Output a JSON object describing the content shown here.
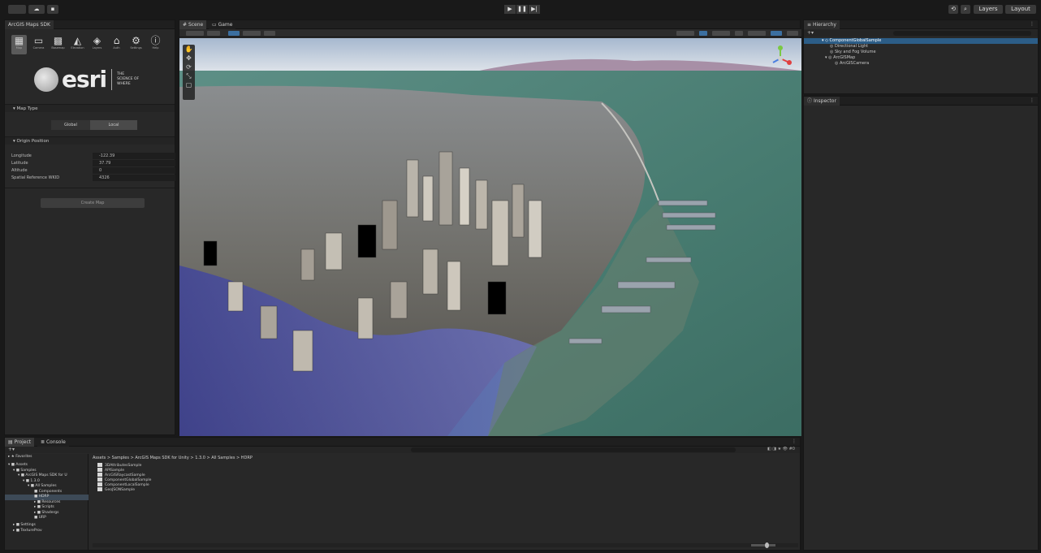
{
  "topbar": {
    "right_layers": "Layers",
    "right_layout": "Layout",
    "play_icons": [
      "play-icon",
      "pause-icon",
      "step-icon"
    ]
  },
  "arcgis_panel": {
    "tab_title": "ArcGIS Maps SDK",
    "tools": [
      {
        "label": "Map",
        "icon": "map-icon"
      },
      {
        "label": "Camera",
        "icon": "camera-icon"
      },
      {
        "label": "Basemap",
        "icon": "basemap-icon"
      },
      {
        "label": "Elevation",
        "icon": "elevation-icon"
      },
      {
        "label": "Layers",
        "icon": "layers-icon"
      },
      {
        "label": "Auth",
        "icon": "auth-icon"
      },
      {
        "label": "Settings",
        "icon": "settings-icon"
      },
      {
        "label": "Help",
        "icon": "help-icon"
      }
    ],
    "logo_word": "esri",
    "logo_tagline": "THE SCIENCE OF WHERE",
    "map_type_header": "Map Type",
    "map_type_options": [
      "Global",
      "Local"
    ],
    "origin_header": "Origin Position",
    "fields": [
      {
        "label": "Longitude",
        "value": "-122.39"
      },
      {
        "label": "Latitude",
        "value": "37.79"
      },
      {
        "label": "Altitude",
        "value": "0"
      },
      {
        "label": "Spatial Reference WKID",
        "value": "4326"
      }
    ],
    "create_button": "Create Map"
  },
  "scene": {
    "tabs": [
      "Scene",
      "Game"
    ],
    "tool_icons": [
      "hand-icon",
      "move-icon",
      "rotate-icon",
      "scale-icon",
      "rect-icon"
    ]
  },
  "hierarchy": {
    "tab_title": "Hierarchy",
    "items": [
      {
        "label": "ComponentGlobalSample",
        "indent": 1,
        "selected": true
      },
      {
        "label": "Directional Light",
        "indent": 2,
        "selected": false
      },
      {
        "label": "Sky and Fog Volume",
        "indent": 2,
        "selected": false
      },
      {
        "label": "ArcGISMap",
        "indent": 2,
        "selected": false
      },
      {
        "label": "ArcGISCamera",
        "indent": 3,
        "selected": false
      }
    ]
  },
  "inspector": {
    "tab_title": "Inspector"
  },
  "project": {
    "tabs": [
      "Project",
      "Console"
    ],
    "favorites": "Favorites",
    "tree": [
      {
        "label": "Assets",
        "indent": 0,
        "selected": false
      },
      {
        "label": "Samples",
        "indent": 1,
        "selected": false
      },
      {
        "label": "ArcGIS Maps SDK for U",
        "indent": 2,
        "selected": false
      },
      {
        "label": "1.3.0",
        "indent": 3,
        "selected": false
      },
      {
        "label": "All Samples",
        "indent": 4,
        "selected": false
      },
      {
        "label": "Components",
        "indent": 5,
        "selected": false
      },
      {
        "label": "HDRP",
        "indent": 5,
        "selected": true
      },
      {
        "label": "Resources",
        "indent": 5,
        "selected": false
      },
      {
        "label": "Scripts",
        "indent": 5,
        "selected": false
      },
      {
        "label": "Shadergs",
        "indent": 5,
        "selected": false
      },
      {
        "label": "URP",
        "indent": 5,
        "selected": false
      },
      {
        "label": "Settings",
        "indent": 1,
        "selected": false
      },
      {
        "label": "TextureProv",
        "indent": 1,
        "selected": false
      }
    ],
    "breadcrumb": "Assets > Samples > ArcGIS Maps SDK for Unity > 1.3.0 > All Samples > HDRP",
    "files": [
      "3DAttributesSample",
      "APISample",
      "ArcGISRaycastSample",
      "ComponentGlobalSample",
      "ComponentLocalSample",
      "GeoJSONSample"
    ]
  }
}
